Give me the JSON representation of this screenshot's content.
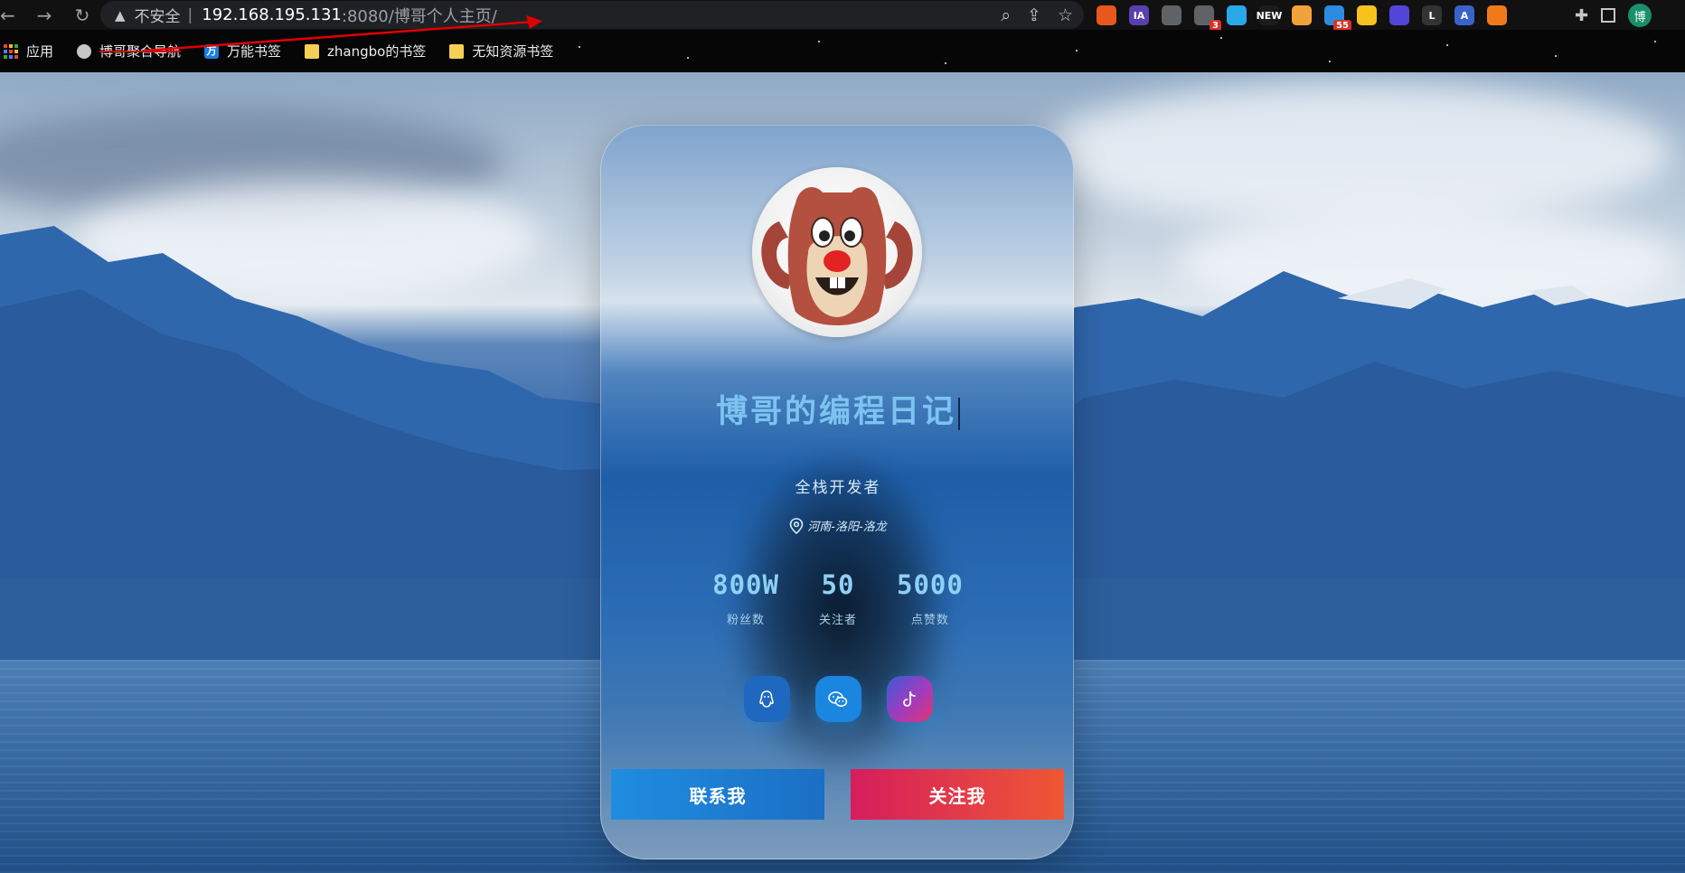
{
  "browser": {
    "security_label": "不安全",
    "url_host": "192.168.195.131",
    "url_path": ":8080/博哥个人主页/",
    "profile_initial": "博",
    "extensions": [
      {
        "name": "ext-firefox-icon",
        "text": "",
        "color": "#e8571b"
      },
      {
        "name": "ext-ia-icon",
        "text": "IA",
        "color": "#5a3fb0"
      },
      {
        "name": "ext-reader-icon",
        "text": "",
        "color": "#5f6368"
      },
      {
        "name": "ext-capture-icon",
        "text": "",
        "color": "#5f6368",
        "badge": "3"
      },
      {
        "name": "ext-diamond-icon",
        "text": "",
        "color": "#29a8e8"
      },
      {
        "name": "ext-new-icon",
        "text": "NEW",
        "color": "#1c1c1c"
      },
      {
        "name": "ext-swirl-icon",
        "text": "",
        "color": "#f2a23a"
      },
      {
        "name": "ext-grid-icon",
        "text": "",
        "color": "#2b8ce0",
        "badge": "55"
      },
      {
        "name": "ext-note-icon",
        "text": "",
        "color": "#f6c21c"
      },
      {
        "name": "ext-orb-icon",
        "text": "",
        "color": "#5246d8"
      },
      {
        "name": "ext-l-icon",
        "text": "L",
        "color": "#333333"
      },
      {
        "name": "ext-a-icon",
        "text": "A",
        "color": "#3a63c9"
      },
      {
        "name": "ext-moon-icon",
        "text": "",
        "color": "#f07a1a"
      }
    ]
  },
  "bookmarks": [
    {
      "name": "bookmark-apps",
      "label": "应用",
      "icon": "apps-icon"
    },
    {
      "name": "bookmark-bogegezonghe",
      "label": "博哥聚合导航",
      "icon": "globe-icon",
      "struck": true
    },
    {
      "name": "bookmark-wanneng",
      "label": "万能书签",
      "icon": "wanneng-icon"
    },
    {
      "name": "bookmark-zhangbo",
      "label": "zhangbo的书签",
      "icon": "folder-icon"
    },
    {
      "name": "bookmark-wuzhi",
      "label": "无知资源书签",
      "icon": "folder-icon"
    }
  ],
  "card": {
    "title": "博哥的编程日记",
    "subtitle": "全栈开发者",
    "location": "河南-洛阳-洛龙",
    "stats": [
      {
        "value": "800W",
        "label": "粉丝数"
      },
      {
        "value": "50",
        "label": "关注者"
      },
      {
        "value": "5000",
        "label": "点赞数"
      }
    ],
    "contact_label": "联系我",
    "follow_label": "关注我"
  },
  "colors": {
    "accent_blue": "#1b6fc4",
    "accent_red": "#e23a4a",
    "title_blue": "#7cc4f0"
  }
}
